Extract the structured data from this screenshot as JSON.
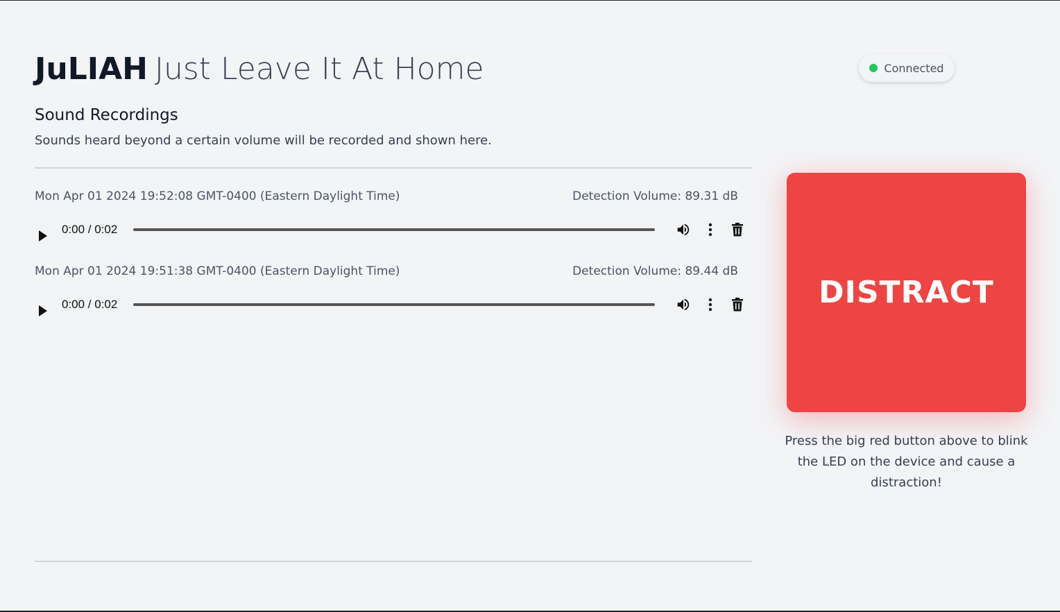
{
  "header": {
    "brand": "JuLIAH",
    "tagline": "Just Leave It At Home"
  },
  "status": {
    "label": "Connected",
    "color": "#22c55e"
  },
  "recordings_section": {
    "title": "Sound Recordings",
    "description": "Sounds heard beyond a certain volume will be recorded and shown here."
  },
  "recordings": [
    {
      "timestamp": "Mon Apr 01 2024 19:52:08 GMT-0400 (Eastern Daylight Time)",
      "volume": "Detection Volume: 89.31 dB",
      "time": "0:00 / 0:02",
      "progress": 0
    },
    {
      "timestamp": "Mon Apr 01 2024 19:51:38 GMT-0400 (Eastern Daylight Time)",
      "volume": "Detection Volume: 89.44 dB",
      "time": "0:00 / 0:02",
      "progress": 0
    }
  ],
  "distract": {
    "label": "DISTRACT",
    "hint": "Press the big red button above to blink the LED on the device and cause a distraction!",
    "color": "#ef4444"
  }
}
